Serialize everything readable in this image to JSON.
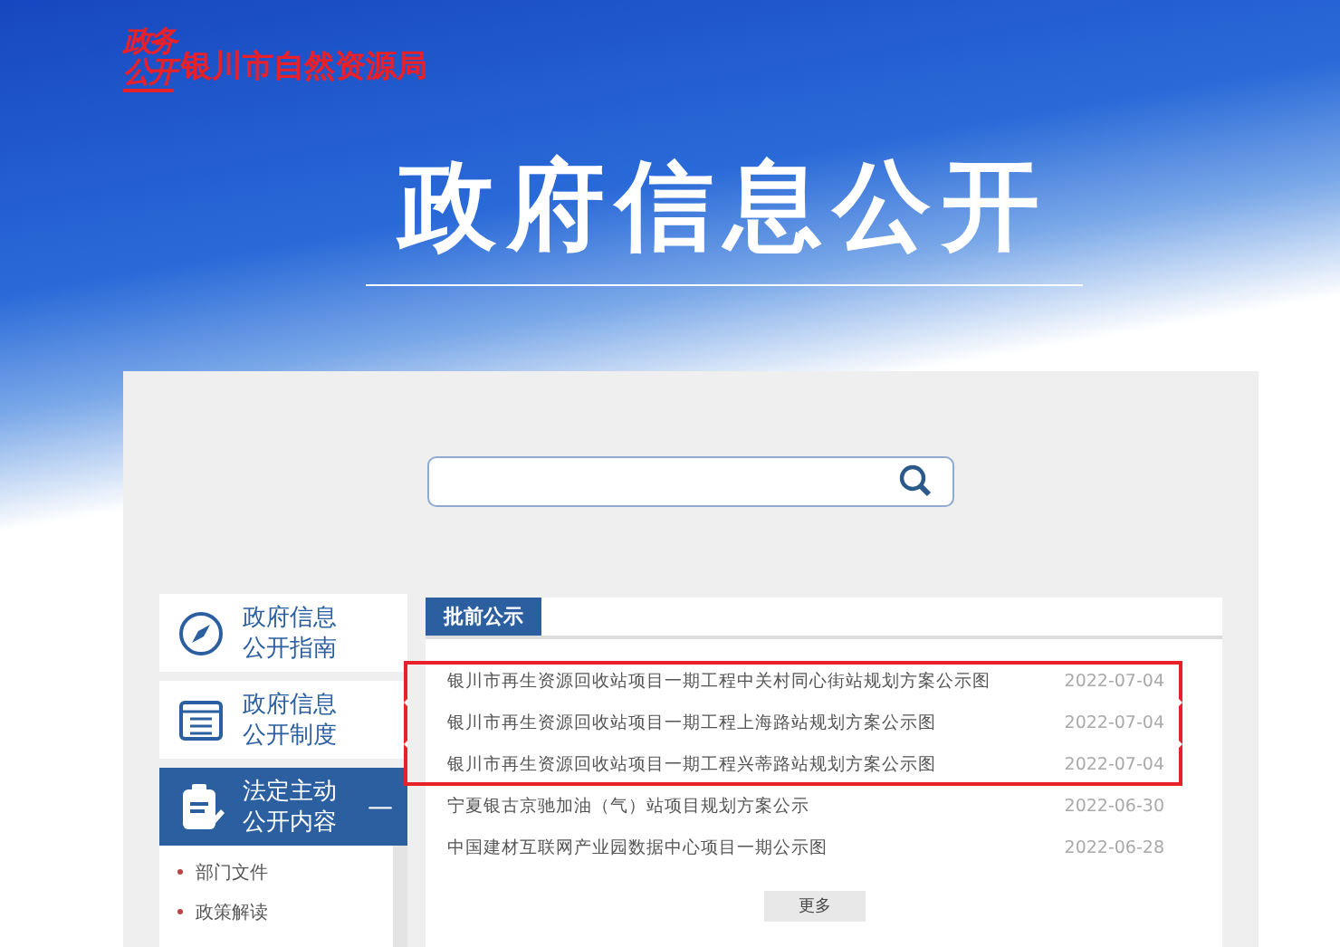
{
  "header": {
    "logo": [
      "政务",
      "公开"
    ],
    "org_name": "银川市自然资源局",
    "title": "政府信息公开"
  },
  "sidebar": {
    "items": [
      {
        "kind": "compass",
        "label": [
          "政府信息",
          "公开指南"
        ],
        "selected": false
      },
      {
        "kind": "list",
        "label": [
          "政府信息",
          "公开制度"
        ],
        "selected": false
      },
      {
        "kind": "edit",
        "label": [
          "法定主动",
          "公开内容"
        ],
        "selected": true,
        "toggle": "—",
        "children": [
          {
            "label": "部门文件"
          },
          {
            "label": "政策解读"
          }
        ]
      }
    ]
  },
  "notices": {
    "tab": "批前公示",
    "rows": [
      {
        "title": "银川市再生资源回收站项目一期工程中关村同心街站规划方案公示图",
        "date": "2022-07-04",
        "highlighted": true
      },
      {
        "title": "银川市再生资源回收站项目一期工程上海路站规划方案公示图",
        "date": "2022-07-04",
        "highlighted": true
      },
      {
        "title": "银川市再生资源回收站项目一期工程兴蒂路站规划方案公示图",
        "date": "2022-07-04",
        "highlighted": true
      },
      {
        "title": "宁夏银古京驰加油（气）站项目规划方案公示",
        "date": "2022-06-30",
        "highlighted": false
      },
      {
        "title": "中国建材互联网产业园数据中心项目一期公示图",
        "date": "2022-06-28",
        "highlighted": false
      }
    ],
    "more": "更多"
  }
}
